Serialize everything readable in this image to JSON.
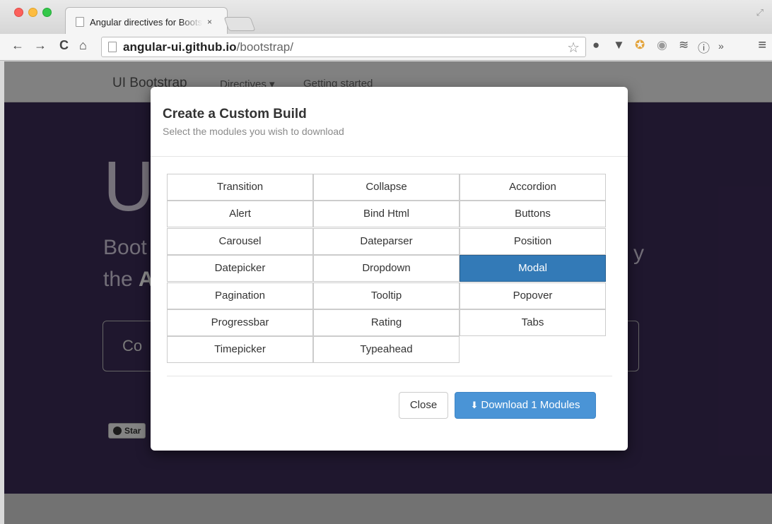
{
  "browser": {
    "tab_title": "Angular directives for Bootstrap",
    "tab_close": "×",
    "url_host": "angular-ui.github.io",
    "url_path": "/bootstrap/",
    "nav_back": "←",
    "nav_forward": "→",
    "nav_reload": "C",
    "nav_home": "⌂",
    "more_extensions": "»"
  },
  "site": {
    "brand": "UI Bootstrap",
    "nav": [
      "Directives ▾",
      "Getting started"
    ],
    "hero_title": "U",
    "hero_line1": "Boot",
    "hero_line1_tail": "y",
    "hero_line2_prefix": "the ",
    "hero_line2_bold": "A",
    "code_button": "Co",
    "github_star": "Star"
  },
  "modal": {
    "title": "Create a Custom Build",
    "subtitle": "Select the modules you wish to download",
    "modules": [
      "Transition",
      "Collapse",
      "Accordion",
      "Alert",
      "Bind Html",
      "Buttons",
      "Carousel",
      "Dateparser",
      "Position",
      "Datepicker",
      "Dropdown",
      "Modal",
      "Pagination",
      "Tooltip",
      "Popover",
      "Progressbar",
      "Rating",
      "Tabs",
      "Timepicker",
      "Typeahead"
    ],
    "selected": [
      "Modal"
    ],
    "close_label": "Close",
    "download_label": "Download 1 Modules",
    "download_icon": "download-icon"
  },
  "colors": {
    "selected": "#337ab7",
    "download_button": "#4a94d6",
    "hero_background": "#3a2a55"
  }
}
